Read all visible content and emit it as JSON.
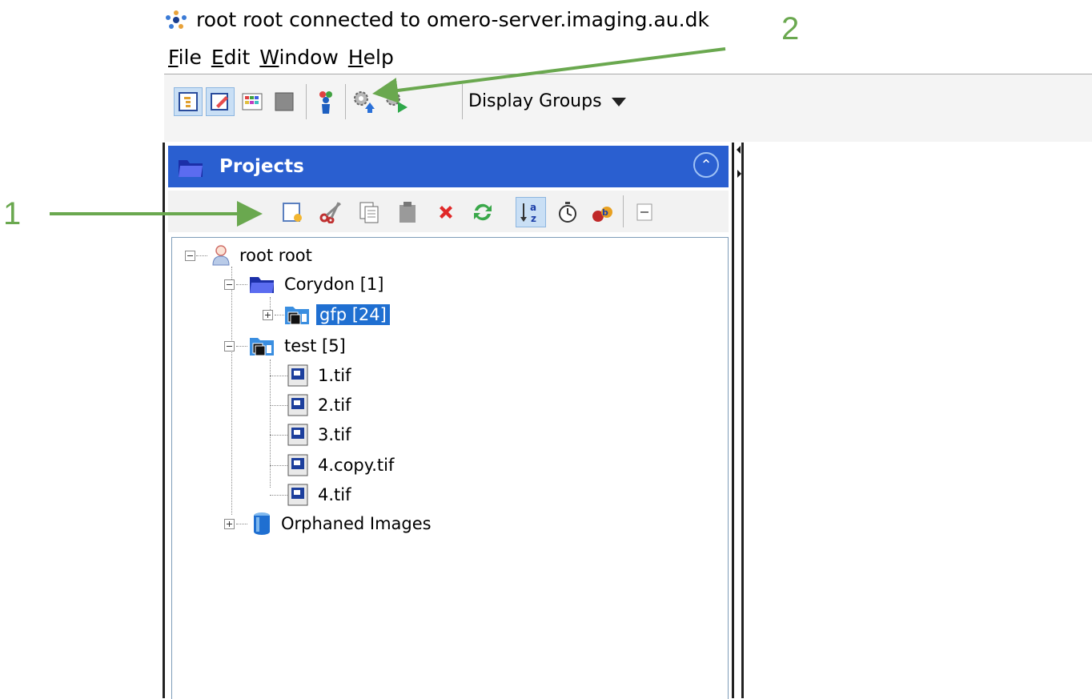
{
  "window": {
    "title": "root root connected to omero-server.imaging.au.dk"
  },
  "menubar": {
    "items": [
      "File",
      "Edit",
      "Window",
      "Help"
    ]
  },
  "toolbar": {
    "display_groups_label": "Display Groups"
  },
  "panel": {
    "title": "Projects"
  },
  "tree": {
    "root": "root root",
    "corydon": "Corydon [1]",
    "gfp": "gfp [24]",
    "test": "test [5]",
    "images": [
      "1.tif",
      "2.tif",
      "3.tif",
      "4.copy.tif",
      "4.tif"
    ],
    "orphaned": "Orphaned Images"
  },
  "annotations": {
    "label_1": "1",
    "label_2": "2",
    "arrow_color": "#6aa84f"
  },
  "colors": {
    "panel_header": "#2a5fd0",
    "selection": "#1f6fd1"
  }
}
